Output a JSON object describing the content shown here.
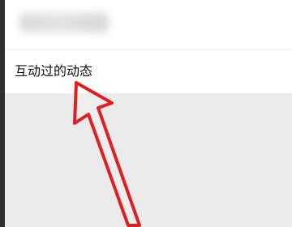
{
  "list": {
    "items": [
      {
        "label": "互动过的动态"
      }
    ]
  },
  "colors": {
    "annotation_arrow": "#e02020",
    "page_background": "#ebebeb",
    "panel_background": "#ffffff"
  },
  "icons": {
    "annotation": "arrow-icon"
  }
}
